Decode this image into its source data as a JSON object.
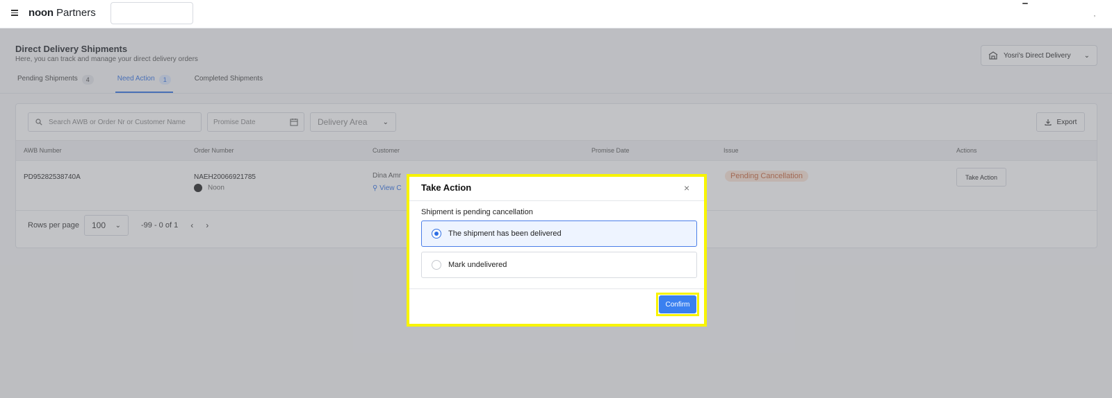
{
  "header": {
    "logo_bold": "noon",
    "logo_light": "Partners",
    "corner_mark": "ʼ"
  },
  "page": {
    "title": "Direct Delivery Shipments",
    "subtitle": "Here, you can track and manage your direct delivery orders",
    "store_selector": "Yosri's Direct Delivery"
  },
  "tabs": [
    {
      "label": "Pending Shipments",
      "count": "4"
    },
    {
      "label": "Need Action",
      "count": "1"
    },
    {
      "label": "Completed Shipments",
      "count": ""
    }
  ],
  "filters": {
    "search_placeholder": "Search AWB or Order Nr or Customer Name",
    "promise_date_placeholder": "Promise Date",
    "delivery_area_placeholder": "Delivery Area",
    "export_label": "Export"
  },
  "table": {
    "columns": [
      "AWB Number",
      "Order Number",
      "Customer",
      "Promise Date",
      "Issue",
      "Actions"
    ],
    "rows": [
      {
        "awb": "PD95282538740A",
        "order_number": "NAEH20066921785",
        "order_source": "Noon",
        "customer_name": "Dina Amr",
        "customer_link": "View C",
        "issue": "Pending Cancellation",
        "action": "Take Action"
      }
    ]
  },
  "pagination": {
    "rows_per_page_label": "Rows per page",
    "rows_per_page": "100",
    "range": "-99 - 0 of 1"
  },
  "modal": {
    "title": "Take Action",
    "close": "×",
    "label": "Shipment is pending cancellation",
    "options": [
      {
        "label": "The shipment has been delivered",
        "selected": true
      },
      {
        "label": "Mark undelivered",
        "selected": false
      }
    ],
    "confirm_label": "Confirm"
  },
  "colors": {
    "accent": "#2f6fe4",
    "highlight": "#f8f400",
    "confirm_button": "#3a80f0",
    "issue_pill_bg": "#fbe6d8",
    "issue_pill_text": "#c8643a"
  }
}
